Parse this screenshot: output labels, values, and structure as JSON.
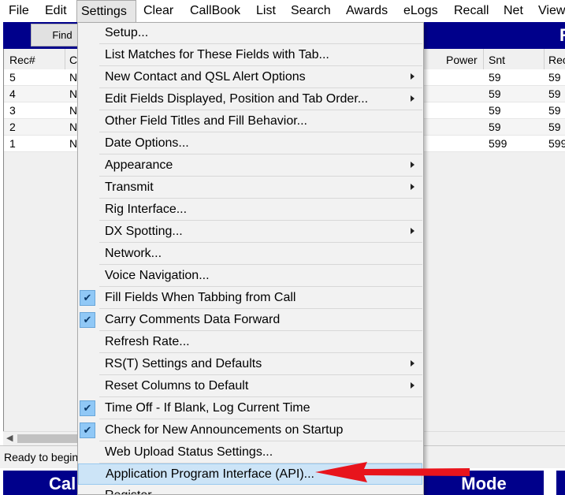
{
  "menubar": {
    "items": [
      {
        "label": "File"
      },
      {
        "label": "Edit"
      },
      {
        "label": "Settings"
      },
      {
        "label": "Clear"
      },
      {
        "label": "CallBook"
      },
      {
        "label": "List"
      },
      {
        "label": "Search"
      },
      {
        "label": "Awards"
      },
      {
        "label": "eLogs"
      },
      {
        "label": "Recall"
      },
      {
        "label": "Net"
      },
      {
        "label": "View"
      }
    ]
  },
  "toolbar": {
    "find_label": "Find",
    "band_letter": "R"
  },
  "grid": {
    "headers": {
      "rec": "Rec#",
      "c": "C",
      "power": "Power",
      "snt": "Snt",
      "rcvd": "Rec"
    },
    "rows": [
      {
        "rec": "5",
        "c": "N",
        "snt": "59",
        "rcvd": "59"
      },
      {
        "rec": "4",
        "c": "N",
        "snt": "59",
        "rcvd": "59"
      },
      {
        "rec": "3",
        "c": "N",
        "snt": "59",
        "rcvd": "59"
      },
      {
        "rec": "2",
        "c": "N",
        "snt": "59",
        "rcvd": "59"
      },
      {
        "rec": "1",
        "c": "N",
        "snt": "599",
        "rcvd": "599"
      }
    ]
  },
  "status": {
    "text": "Ready to begin"
  },
  "bottom": {
    "left_label": "Cal",
    "right_label": "Mode"
  },
  "settings_menu": {
    "items": [
      {
        "label": "Setup...",
        "submenu": false,
        "checked": false
      },
      {
        "label": "List Matches for These Fields with Tab...",
        "submenu": false,
        "checked": false
      },
      {
        "label": "New Contact and QSL Alert Options",
        "submenu": true,
        "checked": false
      },
      {
        "label": "Edit Fields Displayed, Position and Tab Order...",
        "submenu": true,
        "checked": false
      },
      {
        "label": "Other Field Titles and Fill Behavior...",
        "submenu": false,
        "checked": false
      },
      {
        "label": "Date Options...",
        "submenu": false,
        "checked": false
      },
      {
        "label": "Appearance",
        "submenu": true,
        "checked": false
      },
      {
        "label": "Transmit",
        "submenu": true,
        "checked": false
      },
      {
        "label": "Rig Interface...",
        "submenu": false,
        "checked": false
      },
      {
        "label": "DX Spotting...",
        "submenu": true,
        "checked": false
      },
      {
        "label": "Network...",
        "submenu": false,
        "checked": false
      },
      {
        "label": "Voice Navigation...",
        "submenu": false,
        "checked": false
      },
      {
        "label": "Fill Fields When Tabbing from Call",
        "submenu": false,
        "checked": true
      },
      {
        "label": "Carry Comments Data Forward",
        "submenu": false,
        "checked": true
      },
      {
        "label": "Refresh Rate...",
        "submenu": false,
        "checked": false
      },
      {
        "label": "RS(T) Settings and Defaults",
        "submenu": true,
        "checked": false
      },
      {
        "label": "Reset Columns to Default",
        "submenu": true,
        "checked": false
      },
      {
        "label": "Time Off - If Blank, Log Current Time",
        "submenu": false,
        "checked": true
      },
      {
        "label": "Check for New Announcements on Startup",
        "submenu": false,
        "checked": true
      },
      {
        "label": "Web Upload Status Settings...",
        "submenu": false,
        "checked": false
      },
      {
        "label": "Application Program Interface (API)...",
        "submenu": false,
        "checked": false,
        "highlighted": true
      },
      {
        "label": "Register...",
        "submenu": false,
        "checked": false
      }
    ]
  },
  "colors": {
    "band": "#00008b",
    "highlight": "#cce4f7",
    "check": "#90c8f6",
    "annotation": "#e8141c"
  },
  "icons": {
    "checkmark": "check-icon",
    "submenu": "chevron-right-icon",
    "annotation": "red-arrow-icon"
  }
}
